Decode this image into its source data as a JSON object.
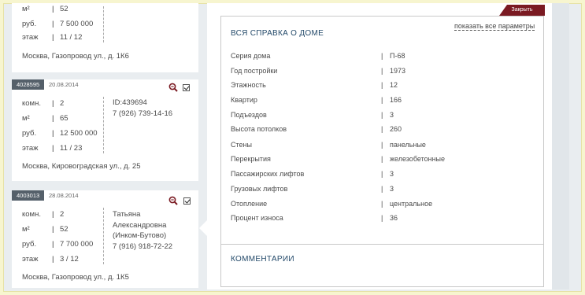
{
  "listings": [
    {
      "rooms_label": "",
      "rooms": "",
      "rows": [
        {
          "k": "м²",
          "v": "52"
        },
        {
          "k": "руб.",
          "v": "7 500 000"
        },
        {
          "k": "этаж",
          "v": "11 / 12"
        }
      ],
      "address": "Москва, Газопровод ул., д. 1К6"
    },
    {
      "id": "4028595",
      "date": "20.08.2014",
      "rows": [
        {
          "k": "комн.",
          "v": "2"
        },
        {
          "k": "м²",
          "v": "65"
        },
        {
          "k": "руб.",
          "v": "12 500 000"
        },
        {
          "k": "этаж",
          "v": "11 / 23"
        }
      ],
      "contact": {
        "line1": "ID:439694",
        "phone": "7 (926) 739-14-16"
      },
      "address": "Москва, Кировоградская ул., д. 25"
    },
    {
      "id": "4003013",
      "date": "28.08.2014",
      "rows": [
        {
          "k": "комн.",
          "v": "2"
        },
        {
          "k": "м²",
          "v": "52"
        },
        {
          "k": "руб.",
          "v": "7 700 000"
        },
        {
          "k": "этаж",
          "v": "3 / 12"
        }
      ],
      "contact": {
        "name1": "Татьяна",
        "name2": "Александровна",
        "name3": "(Инком-Бутово)",
        "phone": "7 (916) 918-72-22"
      },
      "address": "Москва, Газопровод ул., д. 1К5"
    }
  ],
  "panel": {
    "close_label": "Закрыть",
    "show_all": "показать все параметры",
    "section_title": "ВСЯ СПРАВКА О ДОМЕ",
    "properties": [
      {
        "k": "Серия дома",
        "v": "П-68"
      },
      {
        "k": "Год постройки",
        "v": "1973"
      },
      {
        "k": "Этажность",
        "v": "12"
      },
      {
        "k": "Квартир",
        "v": "166"
      },
      {
        "k": "Подъездов",
        "v": "3"
      },
      {
        "k": "Высота потолков",
        "v": "260"
      },
      {
        "k": "Стены",
        "v": "панельные"
      },
      {
        "k": "Перекрытия",
        "v": "железобетонные"
      },
      {
        "k": "Пассажирских лифтов",
        "v": "3"
      },
      {
        "k": "Грузовых лифтов",
        "v": "3"
      },
      {
        "k": "Отопление",
        "v": "центральное"
      },
      {
        "k": "Процент износа",
        "v": "36"
      }
    ],
    "comments_title": "КОММЕНТАРИИ"
  },
  "colors": {
    "accent": "#7a1a22",
    "badge": "#55606a",
    "title": "#244a6a",
    "background": "#f7f5cf"
  }
}
